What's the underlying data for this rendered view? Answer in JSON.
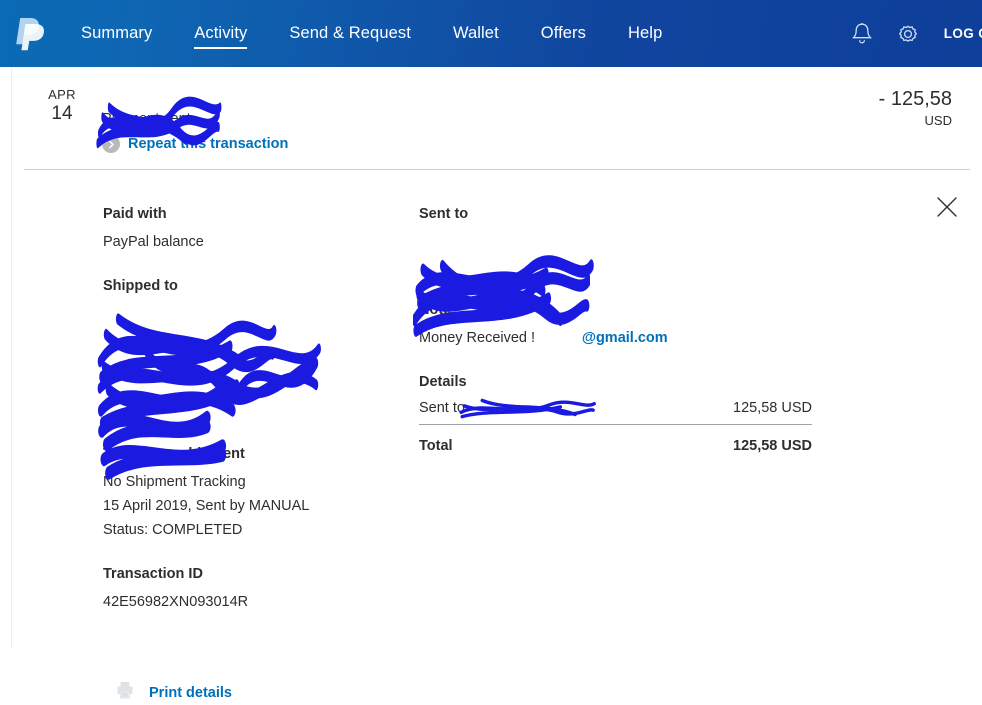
{
  "header": {
    "logo_icon": "paypal-logo-icon",
    "nav": [
      {
        "label": "Summary",
        "active": false
      },
      {
        "label": "Activity",
        "active": true
      },
      {
        "label": "Send & Request",
        "active": false
      },
      {
        "label": "Wallet",
        "active": false
      },
      {
        "label": "Offers",
        "active": false
      },
      {
        "label": "Help",
        "active": false
      }
    ],
    "bell_icon": "notifications-bell-icon",
    "gear_icon": "settings-gear-icon",
    "logout_label": "LOG OUT",
    "brand_color": "#0070ba",
    "header_gradient_from": "#0b6bb5",
    "header_gradient_to": "#0e3f9a"
  },
  "transaction": {
    "date_month": "APR",
    "date_day": "14",
    "payee_name": "[redacted]",
    "status": "Payment sent",
    "repeat_label": "Repeat this transaction",
    "repeat_icon": "chevron-right-circle-icon",
    "amount": "- 125,58",
    "currency": "USD"
  },
  "details": {
    "close_icon": "close-icon",
    "paid_with": {
      "title": "Paid with",
      "value": "PayPal balance"
    },
    "shipped_to": {
      "title": "Shipped to",
      "lines": [
        "[redacted line 1]",
        "[redacted line 2 longer]",
        "[redacted 3]",
        "[red 4]",
        "[redact5]"
      ]
    },
    "tracking": {
      "title": "Track your shipment",
      "lines": [
        "No Shipment Tracking",
        "15 April 2019, Sent by MANUAL",
        "Status: COMPLETED"
      ]
    },
    "transaction_id": {
      "title": "Transaction ID",
      "value": "42E56982XN093014R"
    },
    "sent_to": {
      "title": "Sent to",
      "name": "[redacted name]",
      "email_redacted": "[redacted local]",
      "email_domain": "@gmail.com"
    },
    "note": {
      "title": "Note",
      "value": "Money Received !"
    },
    "summary": {
      "title": "Details",
      "rows": [
        {
          "label": "Sent to",
          "label_redacted": "[redacted recipient]",
          "value": "125,58 USD"
        }
      ],
      "total_label": "Total",
      "total_value": "125,58 USD"
    },
    "print": {
      "icon": "printer-icon",
      "label": "Print details"
    }
  }
}
